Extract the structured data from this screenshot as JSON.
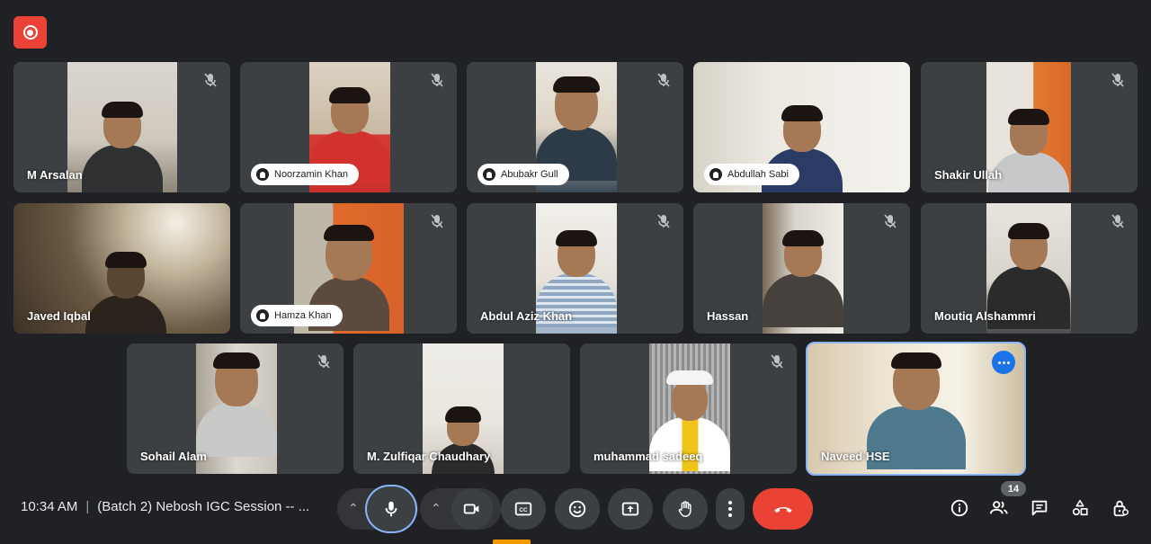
{
  "meeting": {
    "time": "10:34 AM",
    "title": "(Batch 2) Nebosh IGC Session -- ...",
    "participants_count": "14"
  },
  "participants": [
    {
      "name": "M Arsalan"
    },
    {
      "name": "Noorzamin Khan"
    },
    {
      "name": "Abubakr Gull"
    },
    {
      "name": "Abdullah Sabi"
    },
    {
      "name": "Shakir Ullah"
    },
    {
      "name": "Javed Iqbal"
    },
    {
      "name": "Hamza Khan"
    },
    {
      "name": "Abdul Aziz Khan"
    },
    {
      "name": "Hassan"
    },
    {
      "name": "Moutiq Alshammri"
    },
    {
      "name": "Sohail Alam"
    },
    {
      "name": "M. Zulfiqar Chaudhary"
    },
    {
      "name": "muhammad sadeeq"
    },
    {
      "name": "Naveed HSE"
    }
  ],
  "icons": {
    "recording": "recording-icon",
    "mic_muted": "mic-off-icon",
    "pin": "pin-icon",
    "more": "more-options-icon"
  },
  "colors": {
    "background": "#202124",
    "tile": "#3c4043",
    "end_call": "#ea4335",
    "active_speaker": "#8ab4f8",
    "mic_ring": "#8ab4f8"
  }
}
